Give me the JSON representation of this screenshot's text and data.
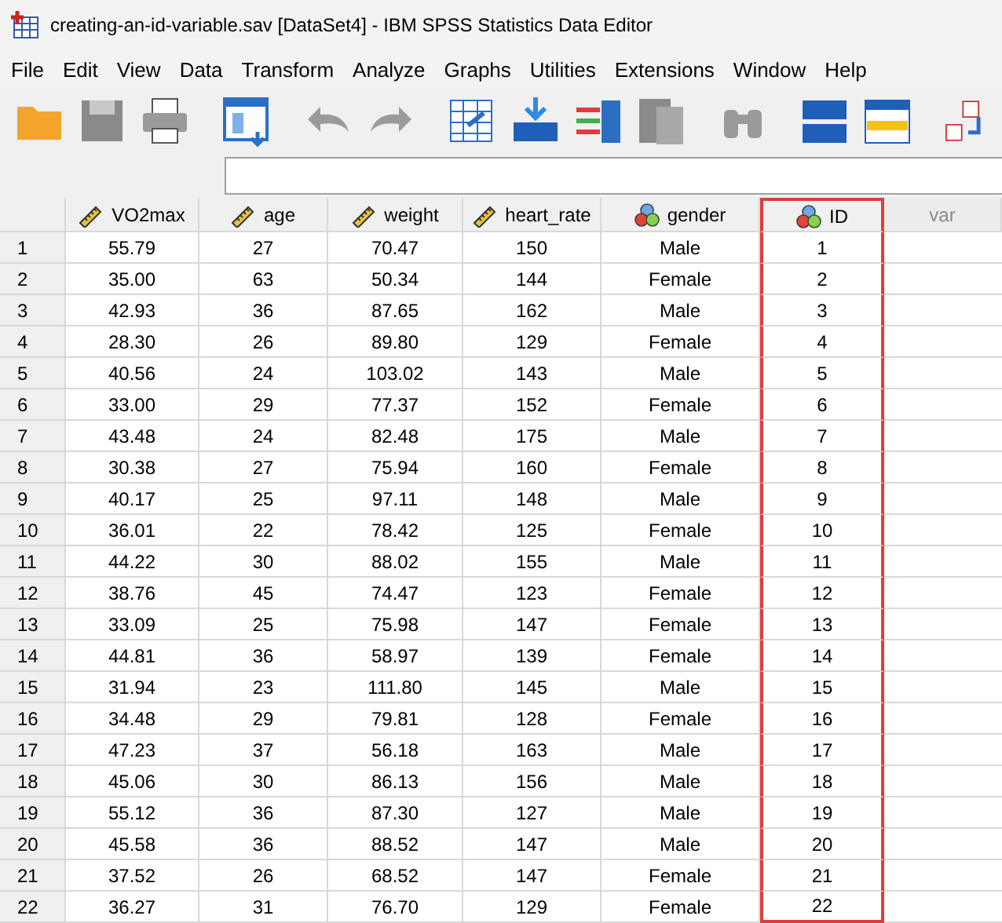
{
  "window": {
    "title": "creating-an-id-variable.sav [DataSet4] - IBM SPSS Statistics Data Editor"
  },
  "menu": [
    "File",
    "Edit",
    "View",
    "Data",
    "Transform",
    "Analyze",
    "Graphs",
    "Utilities",
    "Extensions",
    "Window",
    "Help"
  ],
  "columns": [
    {
      "label": "VO2max",
      "kind": "scale",
      "selected": false
    },
    {
      "label": "age",
      "kind": "scale",
      "selected": false
    },
    {
      "label": "weight",
      "kind": "scale",
      "selected": false
    },
    {
      "label": "heart_rate",
      "kind": "scale",
      "selected": false
    },
    {
      "label": "gender",
      "kind": "nominal",
      "selected": false
    },
    {
      "label": "ID",
      "kind": "nominal",
      "selected": true
    },
    {
      "label": "var",
      "kind": "empty",
      "selected": false
    }
  ],
  "rows": [
    [
      "1",
      "55.79",
      "27",
      "70.47",
      "150",
      "Male",
      "1"
    ],
    [
      "2",
      "35.00",
      "63",
      "50.34",
      "144",
      "Female",
      "2"
    ],
    [
      "3",
      "42.93",
      "36",
      "87.65",
      "162",
      "Male",
      "3"
    ],
    [
      "4",
      "28.30",
      "26",
      "89.80",
      "129",
      "Female",
      "4"
    ],
    [
      "5",
      "40.56",
      "24",
      "103.02",
      "143",
      "Male",
      "5"
    ],
    [
      "6",
      "33.00",
      "29",
      "77.37",
      "152",
      "Female",
      "6"
    ],
    [
      "7",
      "43.48",
      "24",
      "82.48",
      "175",
      "Male",
      "7"
    ],
    [
      "8",
      "30.38",
      "27",
      "75.94",
      "160",
      "Female",
      "8"
    ],
    [
      "9",
      "40.17",
      "25",
      "97.11",
      "148",
      "Male",
      "9"
    ],
    [
      "10",
      "36.01",
      "22",
      "78.42",
      "125",
      "Female",
      "10"
    ],
    [
      "11",
      "44.22",
      "30",
      "88.02",
      "155",
      "Male",
      "11"
    ],
    [
      "12",
      "38.76",
      "45",
      "74.47",
      "123",
      "Female",
      "12"
    ],
    [
      "13",
      "33.09",
      "25",
      "75.98",
      "147",
      "Female",
      "13"
    ],
    [
      "14",
      "44.81",
      "36",
      "58.97",
      "139",
      "Female",
      "14"
    ],
    [
      "15",
      "31.94",
      "23",
      "111.80",
      "145",
      "Male",
      "15"
    ],
    [
      "16",
      "34.48",
      "29",
      "79.81",
      "128",
      "Female",
      "16"
    ],
    [
      "17",
      "47.23",
      "37",
      "56.18",
      "163",
      "Male",
      "17"
    ],
    [
      "18",
      "45.06",
      "30",
      "86.13",
      "156",
      "Male",
      "18"
    ],
    [
      "19",
      "55.12",
      "36",
      "87.30",
      "127",
      "Male",
      "19"
    ],
    [
      "20",
      "45.58",
      "36",
      "88.52",
      "147",
      "Male",
      "20"
    ],
    [
      "21",
      "37.52",
      "26",
      "68.52",
      "147",
      "Female",
      "21"
    ],
    [
      "22",
      "36.27",
      "31",
      "76.70",
      "129",
      "Female",
      "22"
    ]
  ]
}
